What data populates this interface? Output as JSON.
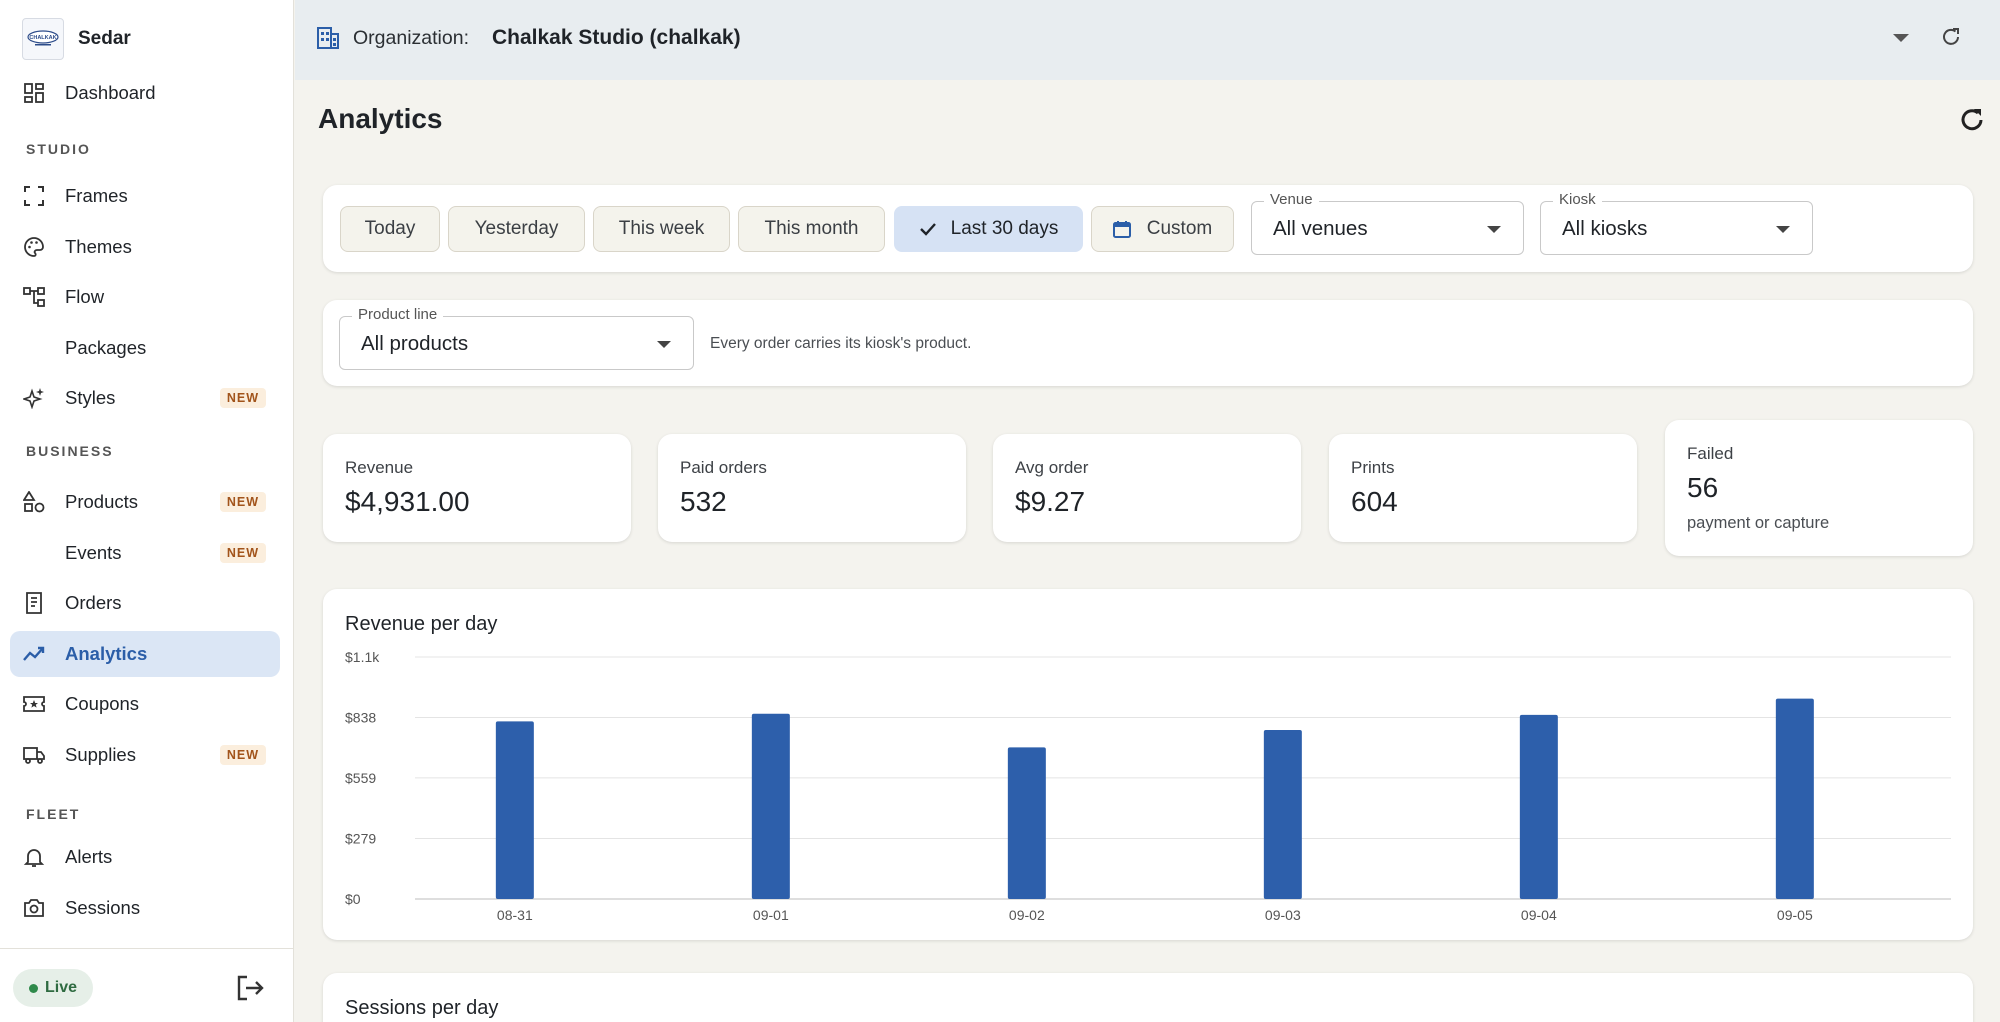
{
  "brand": {
    "name": "Sedar",
    "logo_text": "CHALKAK"
  },
  "colors": {
    "accent": "#2b5ea8",
    "bar": "#2d5fab",
    "active_bg": "#dbe6f5",
    "badge_text": "#a2541b",
    "badge_bg": "#fbeedd"
  },
  "sidebar": {
    "top_items": [
      {
        "label": "Dashboard",
        "icon": "dashboard-icon"
      }
    ],
    "sections": [
      {
        "label": "STUDIO",
        "items": [
          {
            "label": "Frames",
            "icon": "frame-icon",
            "badge": ""
          },
          {
            "label": "Themes",
            "icon": "palette-icon",
            "badge": ""
          },
          {
            "label": "Flow",
            "icon": "flow-icon",
            "badge": ""
          },
          {
            "label": "Packages",
            "icon": "",
            "badge": ""
          },
          {
            "label": "Styles",
            "icon": "sparkle-icon",
            "badge": "NEW"
          }
        ]
      },
      {
        "label": "BUSINESS",
        "items": [
          {
            "label": "Products",
            "icon": "shapes-icon",
            "badge": "NEW"
          },
          {
            "label": "Events",
            "icon": "",
            "badge": "NEW"
          },
          {
            "label": "Orders",
            "icon": "receipt-icon",
            "badge": ""
          },
          {
            "label": "Analytics",
            "icon": "trending-icon",
            "badge": "",
            "active": true
          },
          {
            "label": "Coupons",
            "icon": "coupon-icon",
            "badge": ""
          },
          {
            "label": "Supplies",
            "icon": "truck-icon",
            "badge": "NEW"
          }
        ]
      },
      {
        "label": "FLEET",
        "items": [
          {
            "label": "Alerts",
            "icon": "bell-icon",
            "badge": ""
          },
          {
            "label": "Sessions",
            "icon": "camera-icon",
            "badge": ""
          }
        ]
      }
    ],
    "footer": {
      "status": "Live",
      "logout_icon": "logout-icon"
    }
  },
  "topbar": {
    "org_label": "Organization:",
    "org_name": "Chalkak Studio (chalkak)"
  },
  "page": {
    "title": "Analytics"
  },
  "filters": {
    "ranges": [
      "Today",
      "Yesterday",
      "This week",
      "This month",
      "Last 30 days",
      "Custom"
    ],
    "selected_range": "Last 30 days",
    "venue": {
      "label": "Venue",
      "value": "All venues"
    },
    "kiosk": {
      "label": "Kiosk",
      "value": "All kiosks"
    },
    "product_line": {
      "label": "Product line",
      "value": "All products"
    },
    "hint": "Every order carries its kiosk's product."
  },
  "kpis": [
    {
      "label": "Revenue",
      "value": "$4,931.00",
      "sub": ""
    },
    {
      "label": "Paid orders",
      "value": "532",
      "sub": ""
    },
    {
      "label": "Avg order",
      "value": "$9.27",
      "sub": ""
    },
    {
      "label": "Prints",
      "value": "604",
      "sub": ""
    },
    {
      "label": "Failed",
      "value": "56",
      "sub": "payment or capture"
    }
  ],
  "chart_data": {
    "type": "bar",
    "title": "Revenue per day",
    "categories": [
      "08-31",
      "09-01",
      "09-02",
      "09-03",
      "09-04",
      "09-05"
    ],
    "values": [
      820,
      855,
      700,
      780,
      850,
      925
    ],
    "ylim": [
      0,
      1117
    ],
    "yticks": [
      0,
      279,
      559,
      838,
      1117
    ],
    "ytick_labels": [
      "$0",
      "$279",
      "$559",
      "$838",
      "$1.1k"
    ],
    "xlabel": "",
    "ylabel": "",
    "grid": true
  },
  "next_chart": {
    "title": "Sessions per day"
  }
}
